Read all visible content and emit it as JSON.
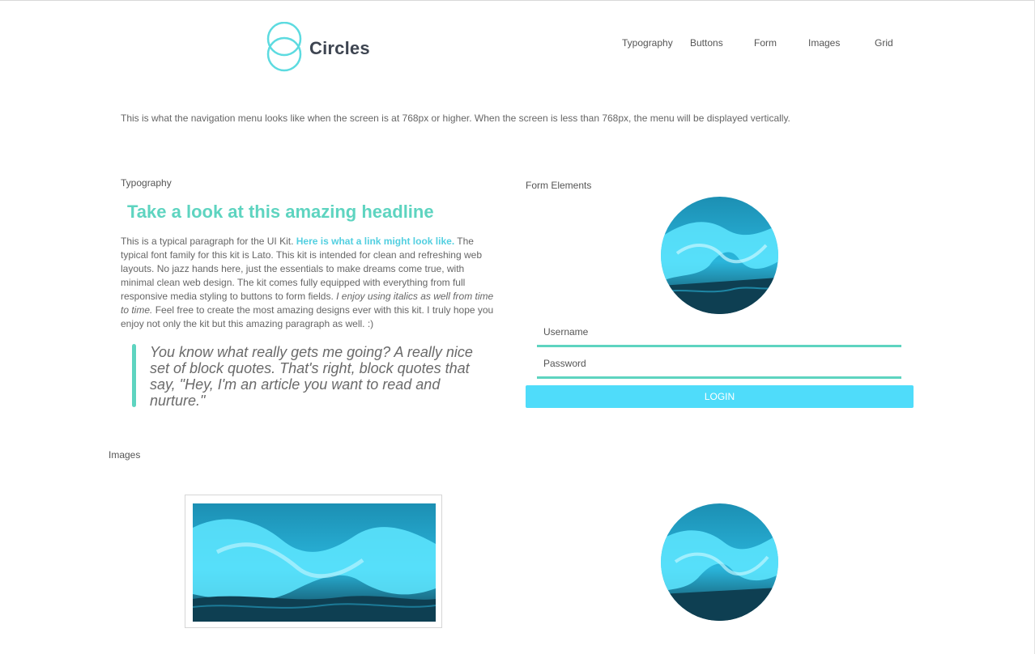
{
  "header": {
    "logo_text": "Circles",
    "nav": [
      "Typography",
      "Buttons",
      "Form",
      "Images",
      "Grid"
    ]
  },
  "intro_text": "This is what the navigation menu looks like when the screen is at 768px or higher. When the screen is less than 768px, the menu will be displayed vertically.",
  "typography": {
    "label": "Typography",
    "headline": "Take a look at this amazing headline",
    "para_1": "This is a typical paragraph for the UI Kit. ",
    "link": "Here is what a link might look like.",
    "para_2": " The typical font family for this kit is Lato. This kit is intended for clean and refreshing web layouts. No jazz hands here, just the essentials to make dreams come true, with minimal clean web design. The kit comes fully equipped with everything from full responsive media styling to buttons to form fields. ",
    "italic": "I enjoy using italics as well from time to time.",
    "para_3": " Feel free to create the most amazing designs ever with this kit. I truly hope you enjoy not only the kit but this amazing paragraph as well. :)",
    "blockquote": "You know what really gets me going? A really nice set of block quotes. That's right, block quotes that say, \"Hey, I'm an article you want to read and nurture.\""
  },
  "form": {
    "label": "Form Elements",
    "username_placeholder": "Username",
    "password_placeholder": "Password",
    "login_label": "LOGIN"
  },
  "images": {
    "label": "Images"
  },
  "colors": {
    "accent_green": "#5ed4c0",
    "link_blue": "#52cfe0",
    "button_cyan": "#4fdcfa",
    "wave_dark": "#0e3f52",
    "wave_light": "#5ee6ff"
  }
}
